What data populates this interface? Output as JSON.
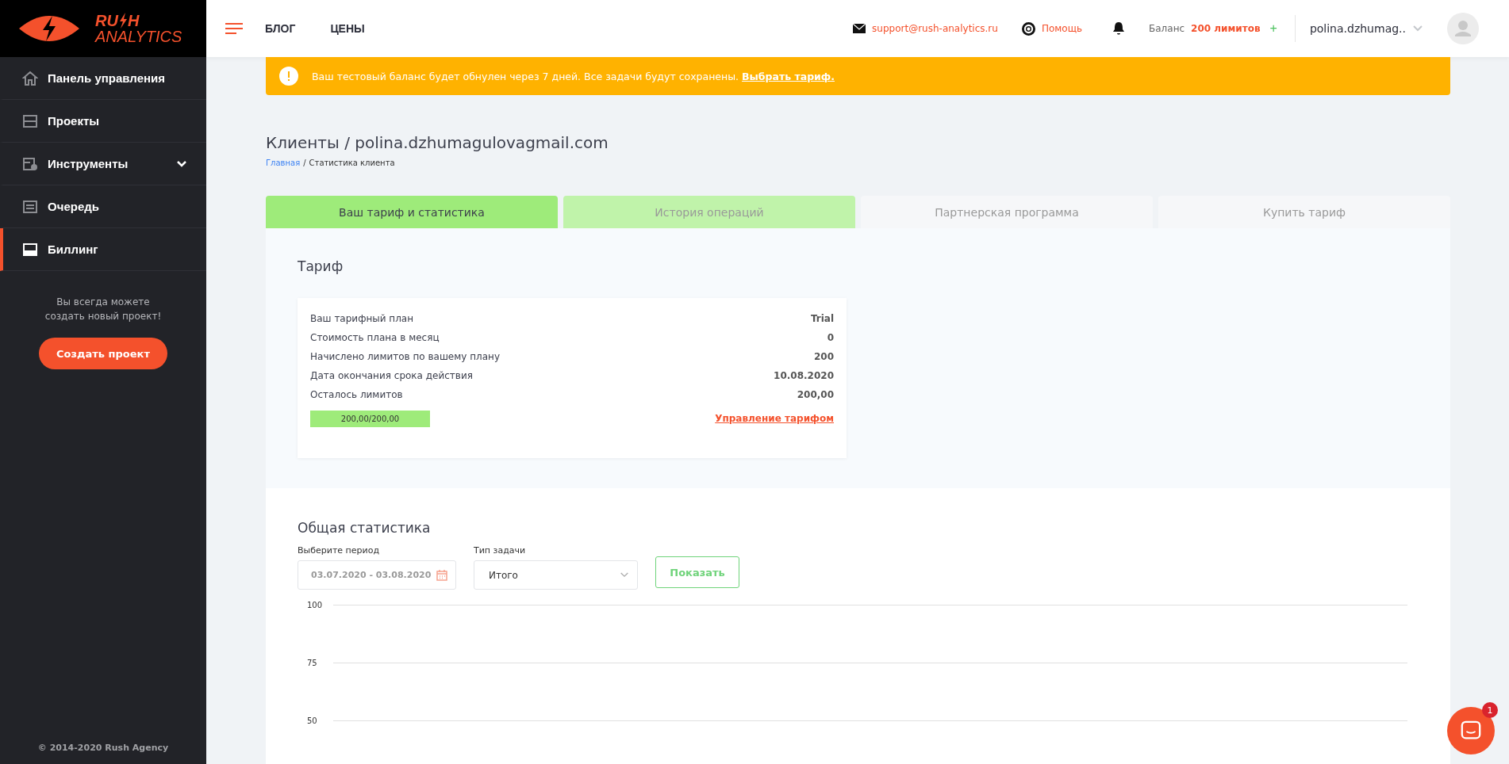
{
  "logo": {
    "word_start": "RU",
    "word_end": "H",
    "subtitle": "ANALYTICS"
  },
  "sidebar": {
    "items": [
      {
        "label": "Панель управления",
        "selected": false
      },
      {
        "label": "Проекты",
        "selected": false
      },
      {
        "label": "Инструменты",
        "selected": false,
        "expanded": false
      },
      {
        "label": "Очередь",
        "selected": false
      },
      {
        "label": "Биллинг",
        "selected": true
      }
    ],
    "promo_text": "Вы всегда можете создать новый проект!",
    "create_button": "Создать проект",
    "footer": "© 2014-2020 Rush Agency"
  },
  "header": {
    "nav": [
      "БЛОГ",
      "ЦЕНЫ"
    ],
    "support_email": "support@rush-analytics.ru",
    "help": "Помощь",
    "balance_label": "Баланс",
    "balance_value": "200 лимитов",
    "add": "+",
    "user": "polina.dzhumag.."
  },
  "banner": {
    "text": "Ваш тестовый баланс будет обнулен через 7 дней. Все задачи будут сохранены.",
    "link": "Выбрать тариф."
  },
  "page_title": "Клиенты / polina.dzhumagulovagmail.com",
  "breadcrumb": {
    "link": "Главная",
    "separator": "/",
    "current": "Статистика клиента"
  },
  "tabs": [
    {
      "label": "Ваш тариф и статистика",
      "selected": true,
      "hovered": false
    },
    {
      "label": "История операций",
      "selected": false,
      "hovered": true
    },
    {
      "label": "Партнерская программа",
      "selected": false,
      "hovered": false
    },
    {
      "label": "Купить тариф",
      "selected": false,
      "hovered": false
    }
  ],
  "tariff": {
    "title": "Тариф",
    "rows": [
      {
        "label": "Ваш тарифный план",
        "value": "Trial"
      },
      {
        "label": "Стоимость плана в месяц",
        "value": "0"
      },
      {
        "label": "Начислено лимитов по вашему плану",
        "value": "200"
      },
      {
        "label": "Дата окончания срока действия",
        "value": "10.08.2020"
      },
      {
        "label": "Осталось лимитов",
        "value": "200,00"
      }
    ],
    "progress": {
      "level": 1,
      "reading": "200,00/200,00"
    },
    "manage_link": "Управление тарифом"
  },
  "stats": {
    "title": "Общая статистика",
    "period_label": "Выберите период",
    "period_value": "03.07.2020 - 03.08.2020",
    "type_label": "Тип задачи",
    "type_value": "Итого",
    "show_button": "Показать",
    "chart_axis_labels": [
      "100",
      "75",
      "50"
    ]
  },
  "chat": {
    "badge": "1"
  }
}
